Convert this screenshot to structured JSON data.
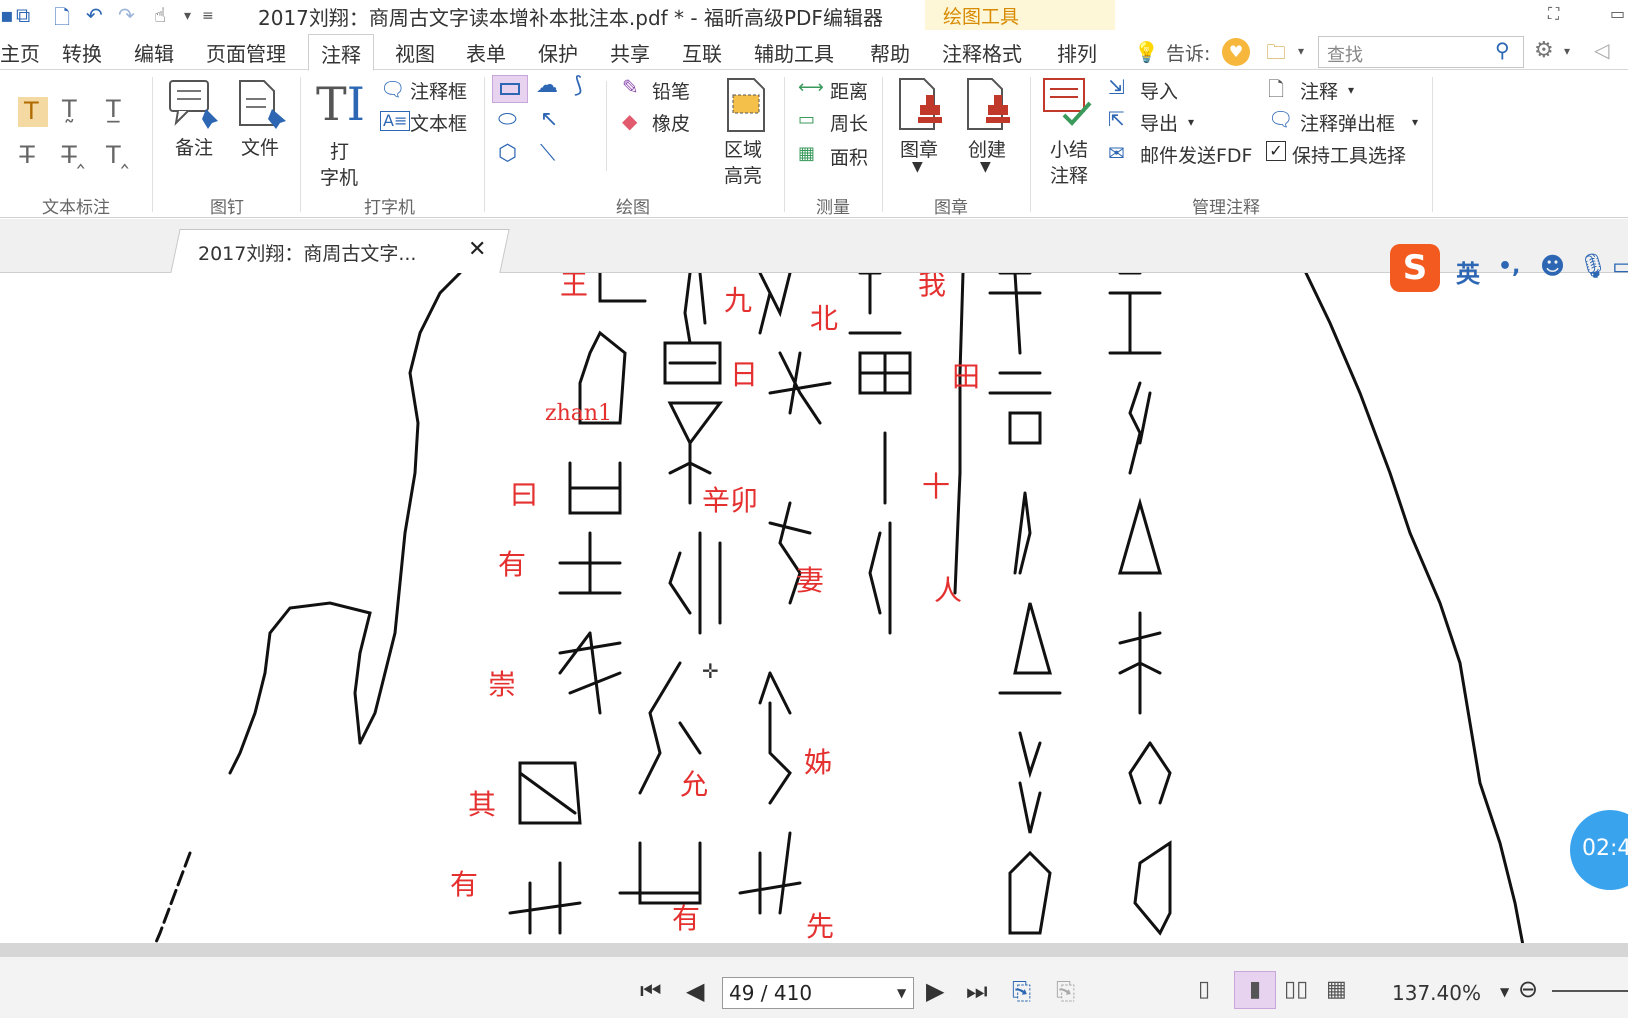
{
  "titlebar": {
    "title": "2017刘翔：商周古文字读本增补本批注本.pdf * - 福昕高级PDF编辑器",
    "context_tab": "绘图工具"
  },
  "menu": {
    "tabs": [
      "主页",
      "转换",
      "编辑",
      "页面管理",
      "注释",
      "视图",
      "表单",
      "保护",
      "共享",
      "互联",
      "辅助工具",
      "帮助",
      "注释格式",
      "排列"
    ],
    "active": "注释",
    "tell_label": "告诉:",
    "search_placeholder": "查找"
  },
  "ribbon": {
    "groups": {
      "text_markup": "文本标注",
      "pin": "图钉",
      "typewriter": "打字机",
      "drawing": "绘图",
      "measure": "测量",
      "stamp": "图章",
      "manage": "管理注释"
    },
    "pin": {
      "note": "备注",
      "file": "文件"
    },
    "typewriter": {
      "tw_line1": "打",
      "tw_line2": "字机",
      "callout": "注释框",
      "textbox": "文本框"
    },
    "drawing": {
      "pencil": "铅笔",
      "eraser": "橡皮"
    },
    "area_highlight": {
      "line1": "区域",
      "line2": "高亮"
    },
    "measure": {
      "distance": "距离",
      "perimeter": "周长",
      "area": "面积"
    },
    "stamp": {
      "stamp": "图章",
      "create": "创建"
    },
    "manage": {
      "summary_line1": "小结",
      "summary_line2": "注释",
      "import": "导入",
      "export": "导出",
      "email_fdf": "邮件发送FDF",
      "comment": "注释",
      "popup": "注释弹出框",
      "keep_tool": "保持工具选择"
    }
  },
  "document": {
    "tab_label": "2017刘翔：商周古文字...",
    "annotations": [
      "王",
      "九",
      "北",
      "我",
      "日",
      "田",
      "zhan1",
      "曰",
      "辛卯",
      "十",
      "有",
      "妻",
      "人",
      "崇",
      "姊",
      "其",
      "允",
      "有",
      "有",
      "先"
    ]
  },
  "ime": {
    "lang": "英",
    "punct": "•,"
  },
  "timer": "02:4",
  "statusbar": {
    "page": "49 / 410",
    "zoom": "137.40%"
  },
  "colors": {
    "accent_blue": "#2d67b4",
    "annotation_red": "#e53030",
    "context_tab_bg": "#fdf7d7",
    "active_tool_bg": "#e7d3ef"
  }
}
